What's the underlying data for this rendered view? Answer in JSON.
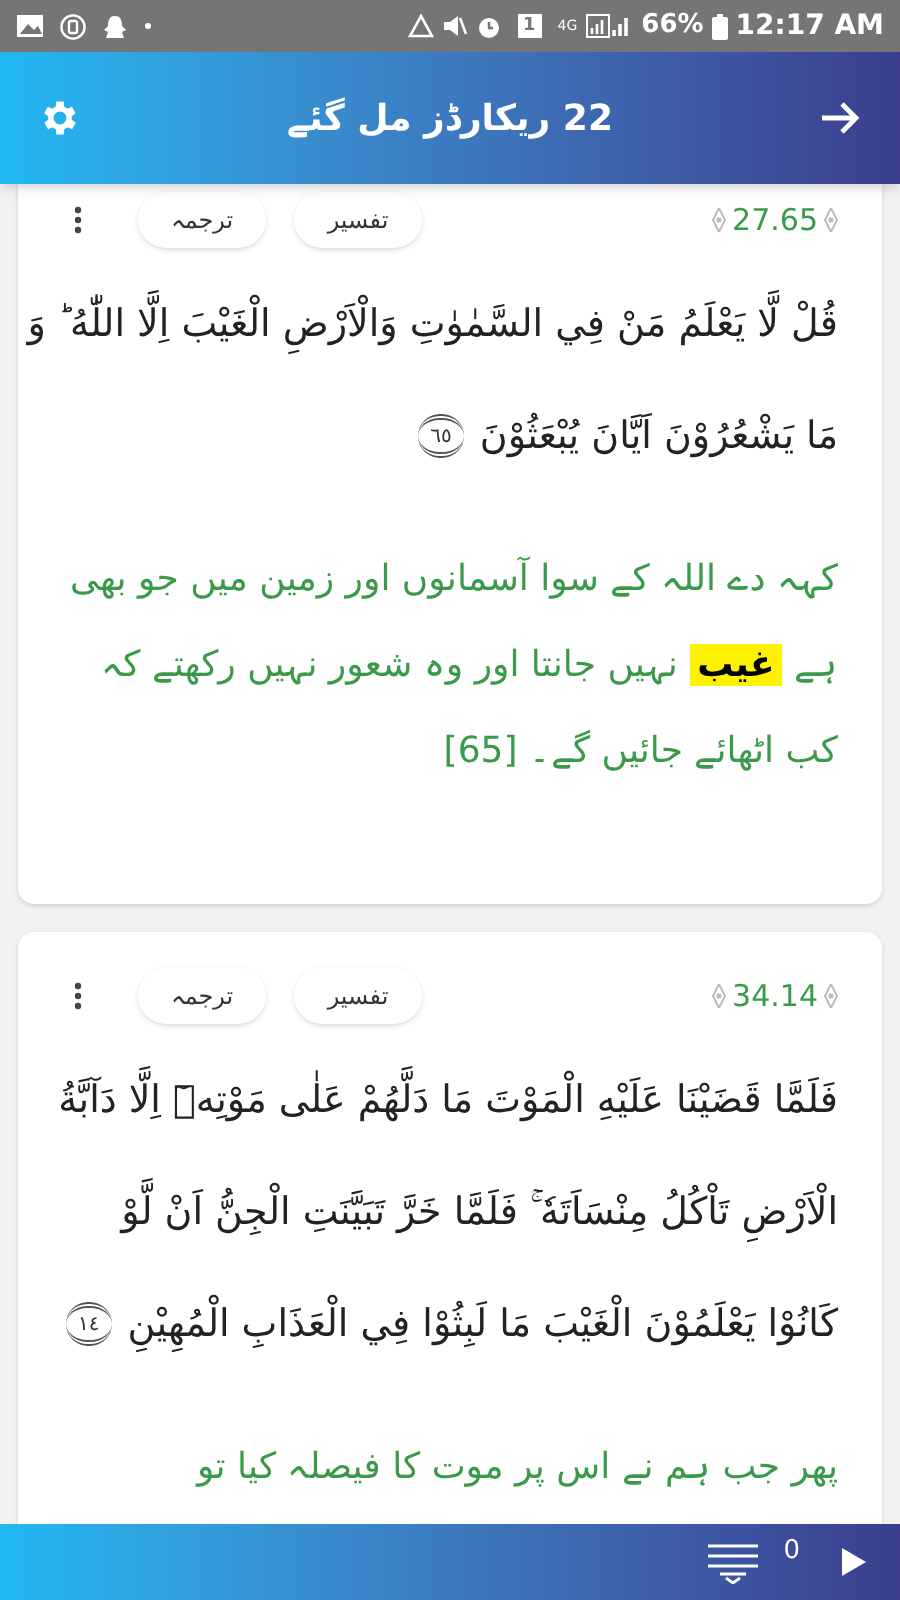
{
  "status_bar": {
    "network": "4G",
    "sim": "1",
    "battery": "66%",
    "time": "12:17 AM"
  },
  "header": {
    "title": "22 ریکارڈز مل گئے"
  },
  "verses": [
    {
      "reference": "27.65",
      "buttons": [
        "تفسیر",
        "ترجمہ"
      ],
      "arabic_lines": [
        "قُلْ لَّا يَعْلَمُ مَنْ فِي السَّمٰوٰتِ وَالْاَرْضِ الْغَيْبَ اِلَّا اللّٰهُ ؕ وَ",
        "مَا يَشْعُرُوْنَ اَيَّانَ يُبْعَثُوْنَ"
      ],
      "ayah_number": "٦٥",
      "translation": "کہہ دے اللہ کے سوا آسمانوں اور زمین میں جو بھی ہے **غیب** نہیں جانتا اور وہ شعور نہیں رکھتے کہ کب اٹھائے جائیں گے۔ [65]"
    },
    {
      "reference": "34.14",
      "buttons": [
        "تفسیر",
        "ترجمہ"
      ],
      "arabic_lines": [
        "فَلَمَّا قَضَيْنَا عَلَيْهِ الْمَوْتَ مَا دَلَّهُمْ عَلٰى مَوْتِهٖٓ اِلَّا دَآبَّةُ",
        "الْاَرْضِ تَاْكُلُ مِنْسَاَتَهٗ ۚ فَلَمَّا خَرَّ تَبَيَّنَتِ الْجِنُّ اَنْ لَّوْ",
        "كَانُوْا يَعْلَمُوْنَ الْغَيْبَ مَا لَبِثُوْا فِي الْعَذَابِ الْمُهِيْنِ"
      ],
      "ayah_number": "١٤",
      "translation": "پھر جب ہم نے اس پر موت کا فیصلہ کیا تو"
    }
  ],
  "bottom_bar": {
    "count": "0"
  }
}
